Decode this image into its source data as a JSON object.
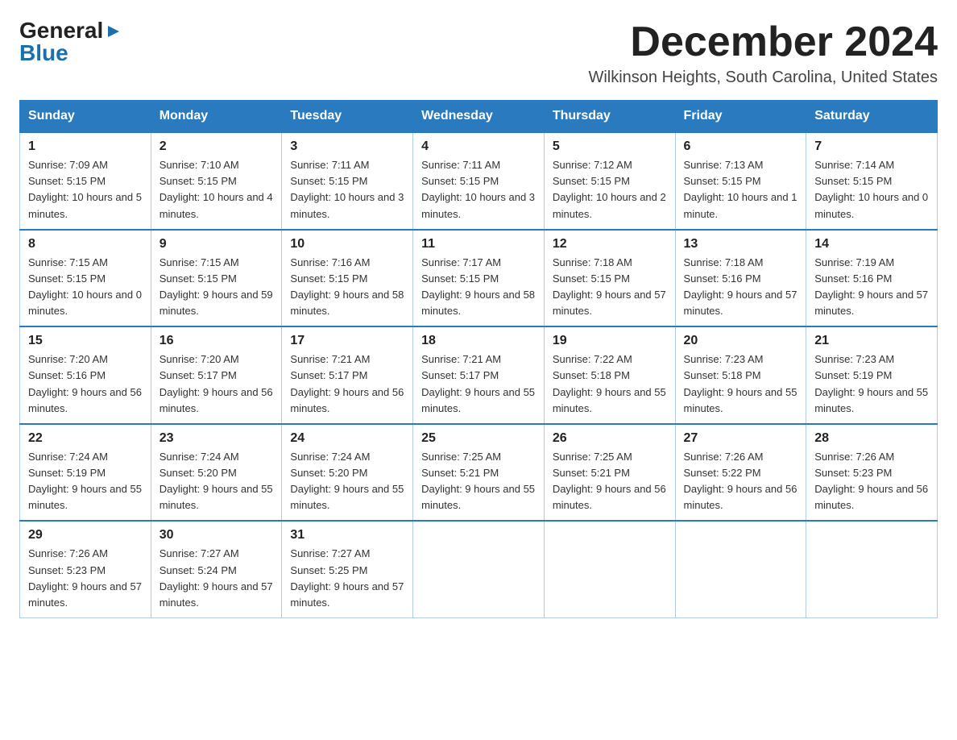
{
  "header": {
    "logo": {
      "general": "General",
      "arrow": "▶",
      "blue": "Blue"
    },
    "title": "December 2024",
    "subtitle": "Wilkinson Heights, South Carolina, United States"
  },
  "calendar": {
    "days_of_week": [
      "Sunday",
      "Monday",
      "Tuesday",
      "Wednesday",
      "Thursday",
      "Friday",
      "Saturday"
    ],
    "weeks": [
      [
        {
          "day": "1",
          "sunrise": "7:09 AM",
          "sunset": "5:15 PM",
          "daylight": "10 hours and 5 minutes."
        },
        {
          "day": "2",
          "sunrise": "7:10 AM",
          "sunset": "5:15 PM",
          "daylight": "10 hours and 4 minutes."
        },
        {
          "day": "3",
          "sunrise": "7:11 AM",
          "sunset": "5:15 PM",
          "daylight": "10 hours and 3 minutes."
        },
        {
          "day": "4",
          "sunrise": "7:11 AM",
          "sunset": "5:15 PM",
          "daylight": "10 hours and 3 minutes."
        },
        {
          "day": "5",
          "sunrise": "7:12 AM",
          "sunset": "5:15 PM",
          "daylight": "10 hours and 2 minutes."
        },
        {
          "day": "6",
          "sunrise": "7:13 AM",
          "sunset": "5:15 PM",
          "daylight": "10 hours and 1 minute."
        },
        {
          "day": "7",
          "sunrise": "7:14 AM",
          "sunset": "5:15 PM",
          "daylight": "10 hours and 0 minutes."
        }
      ],
      [
        {
          "day": "8",
          "sunrise": "7:15 AM",
          "sunset": "5:15 PM",
          "daylight": "10 hours and 0 minutes."
        },
        {
          "day": "9",
          "sunrise": "7:15 AM",
          "sunset": "5:15 PM",
          "daylight": "9 hours and 59 minutes."
        },
        {
          "day": "10",
          "sunrise": "7:16 AM",
          "sunset": "5:15 PM",
          "daylight": "9 hours and 58 minutes."
        },
        {
          "day": "11",
          "sunrise": "7:17 AM",
          "sunset": "5:15 PM",
          "daylight": "9 hours and 58 minutes."
        },
        {
          "day": "12",
          "sunrise": "7:18 AM",
          "sunset": "5:15 PM",
          "daylight": "9 hours and 57 minutes."
        },
        {
          "day": "13",
          "sunrise": "7:18 AM",
          "sunset": "5:16 PM",
          "daylight": "9 hours and 57 minutes."
        },
        {
          "day": "14",
          "sunrise": "7:19 AM",
          "sunset": "5:16 PM",
          "daylight": "9 hours and 57 minutes."
        }
      ],
      [
        {
          "day": "15",
          "sunrise": "7:20 AM",
          "sunset": "5:16 PM",
          "daylight": "9 hours and 56 minutes."
        },
        {
          "day": "16",
          "sunrise": "7:20 AM",
          "sunset": "5:17 PM",
          "daylight": "9 hours and 56 minutes."
        },
        {
          "day": "17",
          "sunrise": "7:21 AM",
          "sunset": "5:17 PM",
          "daylight": "9 hours and 56 minutes."
        },
        {
          "day": "18",
          "sunrise": "7:21 AM",
          "sunset": "5:17 PM",
          "daylight": "9 hours and 55 minutes."
        },
        {
          "day": "19",
          "sunrise": "7:22 AM",
          "sunset": "5:18 PM",
          "daylight": "9 hours and 55 minutes."
        },
        {
          "day": "20",
          "sunrise": "7:23 AM",
          "sunset": "5:18 PM",
          "daylight": "9 hours and 55 minutes."
        },
        {
          "day": "21",
          "sunrise": "7:23 AM",
          "sunset": "5:19 PM",
          "daylight": "9 hours and 55 minutes."
        }
      ],
      [
        {
          "day": "22",
          "sunrise": "7:24 AM",
          "sunset": "5:19 PM",
          "daylight": "9 hours and 55 minutes."
        },
        {
          "day": "23",
          "sunrise": "7:24 AM",
          "sunset": "5:20 PM",
          "daylight": "9 hours and 55 minutes."
        },
        {
          "day": "24",
          "sunrise": "7:24 AM",
          "sunset": "5:20 PM",
          "daylight": "9 hours and 55 minutes."
        },
        {
          "day": "25",
          "sunrise": "7:25 AM",
          "sunset": "5:21 PM",
          "daylight": "9 hours and 55 minutes."
        },
        {
          "day": "26",
          "sunrise": "7:25 AM",
          "sunset": "5:21 PM",
          "daylight": "9 hours and 56 minutes."
        },
        {
          "day": "27",
          "sunrise": "7:26 AM",
          "sunset": "5:22 PM",
          "daylight": "9 hours and 56 minutes."
        },
        {
          "day": "28",
          "sunrise": "7:26 AM",
          "sunset": "5:23 PM",
          "daylight": "9 hours and 56 minutes."
        }
      ],
      [
        {
          "day": "29",
          "sunrise": "7:26 AM",
          "sunset": "5:23 PM",
          "daylight": "9 hours and 57 minutes."
        },
        {
          "day": "30",
          "sunrise": "7:27 AM",
          "sunset": "5:24 PM",
          "daylight": "9 hours and 57 minutes."
        },
        {
          "day": "31",
          "sunrise": "7:27 AM",
          "sunset": "5:25 PM",
          "daylight": "9 hours and 57 minutes."
        },
        null,
        null,
        null,
        null
      ]
    ]
  }
}
